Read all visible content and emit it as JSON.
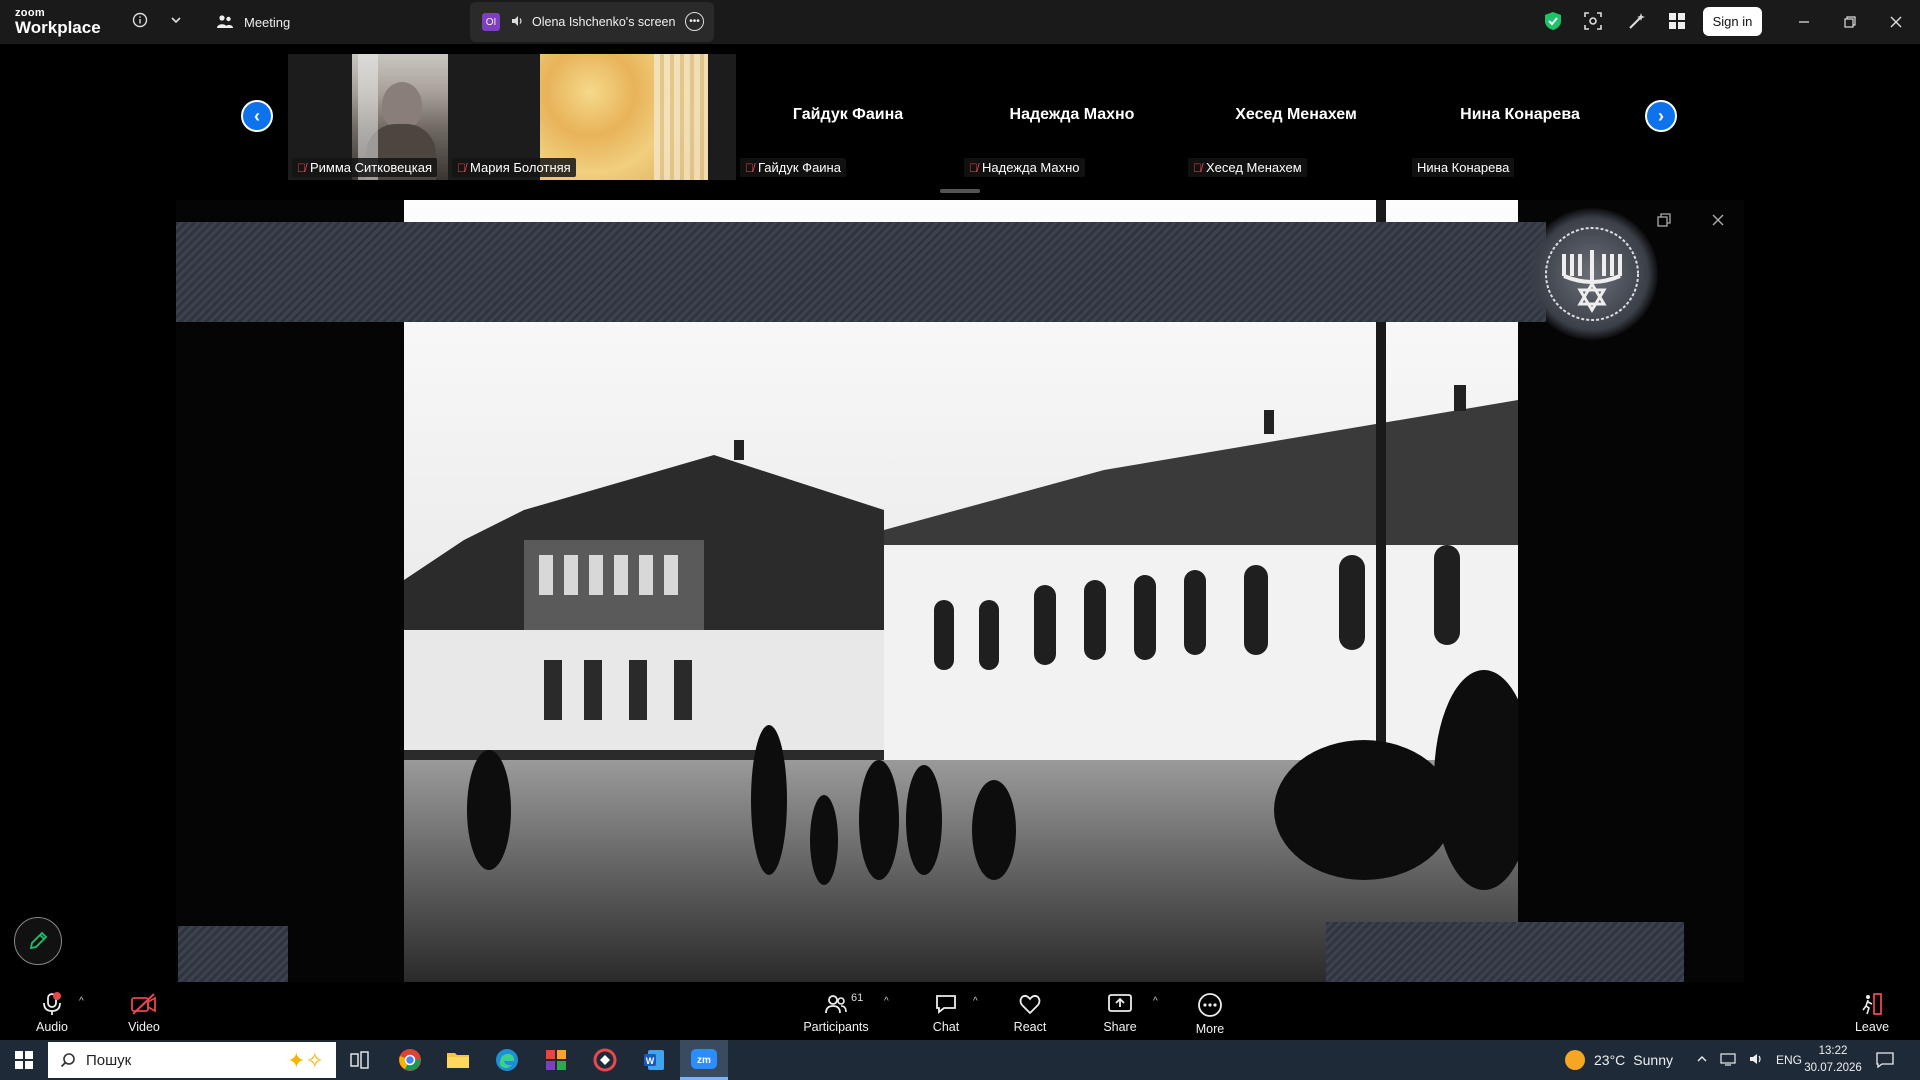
{
  "titlebar": {
    "logo_line1": "zoom",
    "logo_line2": "Workplace",
    "meeting_label": "Meeting",
    "screen_tab_avatar": "OI",
    "screen_tab_label": "Olena Ishchenko's screen",
    "sign_in": "Sign in"
  },
  "strip": {
    "tiles": [
      {
        "name": "Римма Ситковецкая",
        "muted": true,
        "video": true
      },
      {
        "name": "Мария Болотняя",
        "muted": true,
        "video": true
      },
      {
        "name": "Гайдук Фаина",
        "big_name": "Гайдук Фаина",
        "muted": true,
        "video": false
      },
      {
        "name": "Надежда Махно",
        "big_name": "Надежда Махно",
        "muted": true,
        "video": false
      },
      {
        "name": "Хесед Менахем",
        "big_name": "Хесед Менахем",
        "muted": true,
        "video": false
      },
      {
        "name": "Нина Конарева",
        "big_name": "Нина Конарева",
        "muted": false,
        "video": false
      }
    ]
  },
  "toolbar": {
    "audio": "Audio",
    "video": "Video",
    "participants": "Participants",
    "participant_count": "61",
    "chat": "Chat",
    "react": "React",
    "share": "Share",
    "more": "More",
    "leave": "Leave"
  },
  "taskbar": {
    "search_placeholder": "Пошук",
    "weather_temp": "23°C",
    "weather_text": "Sunny",
    "lang": "ENG",
    "time": "13:22",
    "date": "30.07.2026"
  },
  "colors": {
    "accent": "#0e72ed",
    "titlebar": "#1a1a1a",
    "muted": "#e5484d",
    "shield": "#1dc36b"
  }
}
